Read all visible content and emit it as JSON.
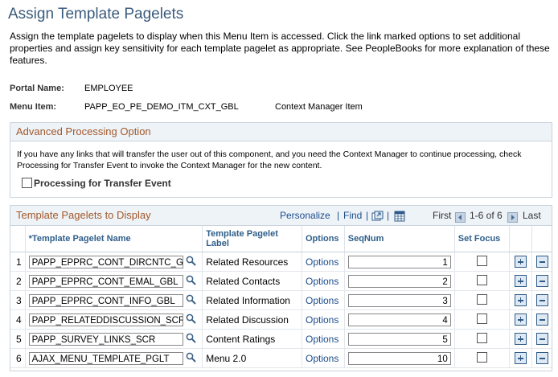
{
  "page": {
    "title": "Assign Template Pagelets",
    "intro": "Assign the template pagelets to display when this Menu Item is accessed. Click the link marked options to set additional properties and assign key sensitivity for each template pagelet as appropriate. See PeopleBooks for more explanation of these features."
  },
  "portal": {
    "label": "Portal Name:",
    "value": "EMPLOYEE"
  },
  "menu_item": {
    "label": "Menu Item:",
    "value": "PAPP_EO_PE_DEMO_ITM_CXT_GBL",
    "desc": "Context Manager Item"
  },
  "advanced": {
    "title": "Advanced Processing Option",
    "text": "If you have any links that will transfer the user out of this component, and you need the Context Manager to continue processing, check Processing for Transfer Event to invoke the Context Manager for the new content.",
    "checkbox_label": "Processing for Transfer Event"
  },
  "grid": {
    "title": "Template Pagelets to Display",
    "personalize": "Personalize",
    "find": "Find",
    "first": "First",
    "range": "1-6 of 6",
    "last": "Last",
    "headers": {
      "name": "*Template Pagelet Name",
      "label": "Template Pagelet Label",
      "options": "Options",
      "seq": "SeqNum",
      "focus": "Set Focus"
    },
    "rows": [
      {
        "num": "1",
        "name": "PAPP_EPPRC_CONT_DIRCNTC_GBL",
        "label": "Related Resources",
        "options": "Options",
        "seq": "1"
      },
      {
        "num": "2",
        "name": "PAPP_EPPRC_CONT_EMAL_GBL",
        "label": "Related Contacts",
        "options": "Options",
        "seq": "2"
      },
      {
        "num": "3",
        "name": "PAPP_EPPRC_CONT_INFO_GBL",
        "label": "Related Information",
        "options": "Options",
        "seq": "3"
      },
      {
        "num": "4",
        "name": "PAPP_RELATEDDISCUSSION_SCR",
        "label": "Related Discussion",
        "options": "Options",
        "seq": "4"
      },
      {
        "num": "5",
        "name": "PAPP_SURVEY_LINKS_SCR",
        "label": "Content Ratings",
        "options": "Options",
        "seq": "5"
      },
      {
        "num": "6",
        "name": "AJAX_MENU_TEMPLATE_PGLT",
        "label": "Menu 2.0",
        "options": "Options",
        "seq": "10"
      }
    ]
  },
  "colors": {
    "title": "#3a5b7d",
    "section_header": "#a2582a",
    "link": "#1c4c8c",
    "header_bg": "#eef3f8"
  },
  "icons": [
    "lookup-icon",
    "view-all-icon",
    "download-icon",
    "prev-arrow-icon",
    "next-arrow-icon",
    "add-row-icon",
    "delete-row-icon"
  ]
}
